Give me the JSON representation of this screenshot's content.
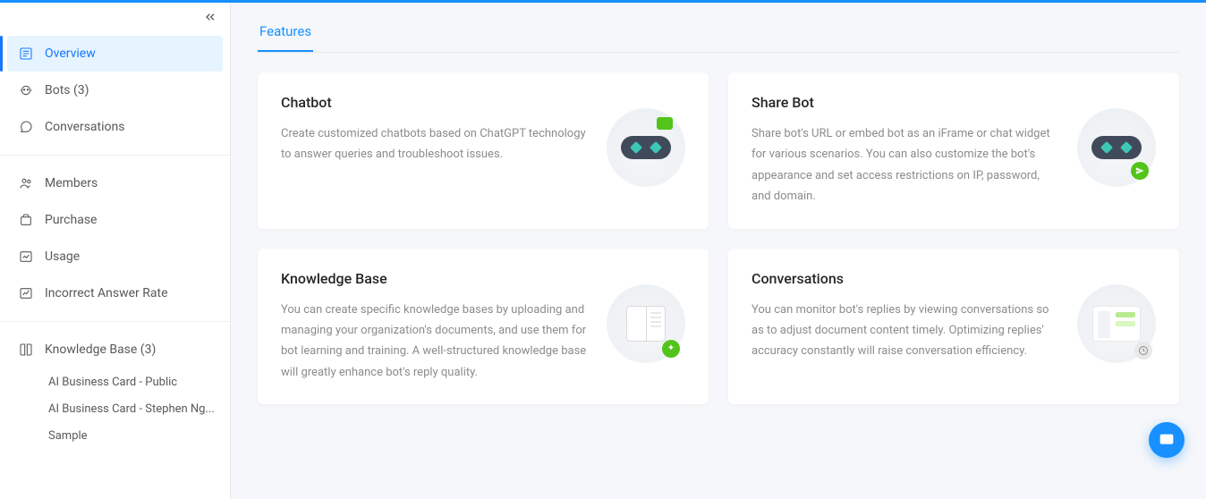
{
  "sidebar": {
    "group1": [
      {
        "label": "Overview",
        "icon": "overview"
      },
      {
        "label": "Bots (3)",
        "icon": "bot"
      },
      {
        "label": "Conversations",
        "icon": "chat"
      }
    ],
    "group2": [
      {
        "label": "Members",
        "icon": "members"
      },
      {
        "label": "Purchase",
        "icon": "purchase"
      },
      {
        "label": "Usage",
        "icon": "usage"
      },
      {
        "label": "Incorrect Answer Rate",
        "icon": "answer"
      }
    ],
    "kb": {
      "label": "Knowledge Base (3)"
    },
    "kb_items": [
      "AI Business Card - Public",
      "AI Business Card - Stephen Ng...",
      "Sample"
    ]
  },
  "tabs": {
    "features": "Features"
  },
  "cards": {
    "chatbot": {
      "title": "Chatbot",
      "desc": "Create customized chatbots based on ChatGPT technology to answer queries and troubleshoot issues."
    },
    "sharebot": {
      "title": "Share Bot",
      "desc": "Share bot's URL or embed bot as an iFrame or chat widget for various scenarios. You can also customize the bot's appearance and set access restrictions on IP, password, and domain."
    },
    "kb": {
      "title": "Knowledge Base",
      "desc": "You can create specific knowledge bases by uploading and managing your organization's documents, and use them for bot learning and training. A well-structured knowledge base will greatly enhance bot's reply quality."
    },
    "conv": {
      "title": "Conversations",
      "desc": "You can monitor bot's replies by viewing conversations so as to adjust document content timely. Optimizing replies' accuracy constantly will raise conversation efficiency."
    }
  }
}
